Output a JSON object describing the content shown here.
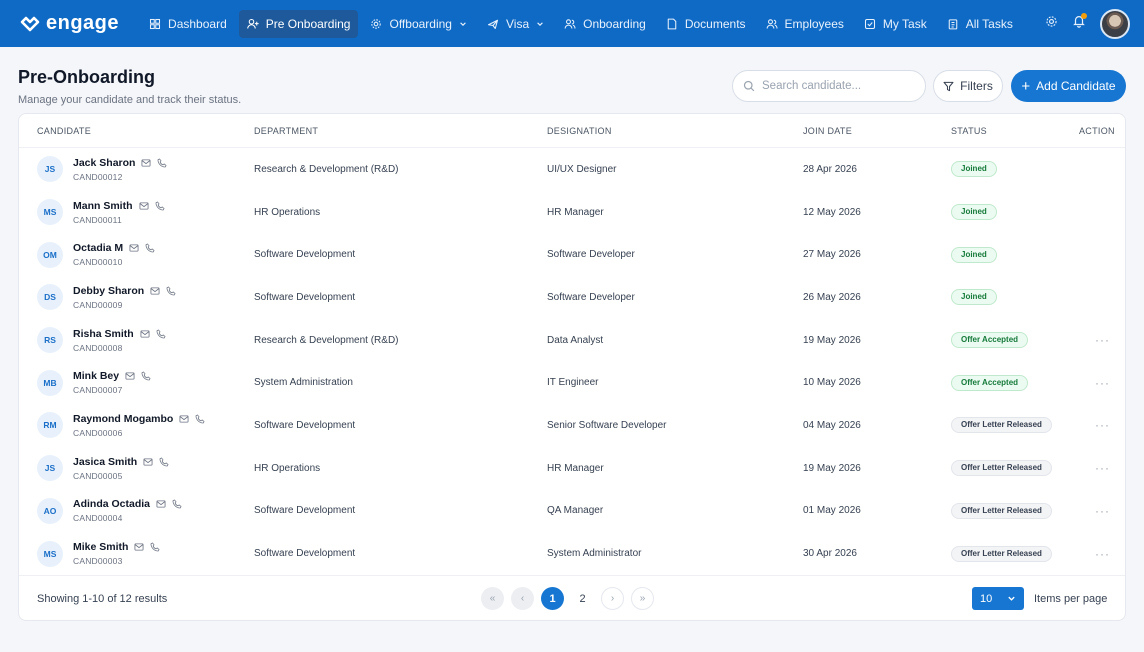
{
  "app": {
    "name": "engage"
  },
  "nav": [
    {
      "label": "Dashboard",
      "icon": "dashboard-icon",
      "active": false,
      "dropdown": false
    },
    {
      "label": "Pre Onboarding",
      "icon": "user-plus-icon",
      "active": true,
      "dropdown": false
    },
    {
      "label": "Offboarding",
      "icon": "gear-icon",
      "active": false,
      "dropdown": true
    },
    {
      "label": "Visa",
      "icon": "plane-icon",
      "active": false,
      "dropdown": true
    },
    {
      "label": "Onboarding",
      "icon": "users-icon",
      "active": false,
      "dropdown": false
    },
    {
      "label": "Documents",
      "icon": "document-icon",
      "active": false,
      "dropdown": false
    },
    {
      "label": "Employees",
      "icon": "users-icon",
      "active": false,
      "dropdown": false
    },
    {
      "label": "My Task",
      "icon": "checkbox-icon",
      "active": false,
      "dropdown": false
    },
    {
      "label": "All Tasks",
      "icon": "clipboard-icon",
      "active": false,
      "dropdown": false
    }
  ],
  "page": {
    "title": "Pre-Onboarding",
    "subtitle": "Manage your candidate and track their status."
  },
  "search": {
    "placeholder": "Search candidate...",
    "value": ""
  },
  "buttons": {
    "filters": "Filters",
    "add": "Add Candidate"
  },
  "table": {
    "headers": [
      "CANDIDATE",
      "DEPARTMENT",
      "DESIGNATION",
      "JOIN DATE",
      "STATUS",
      "ACTION"
    ],
    "rows": [
      {
        "initials": "JS",
        "name": "Jack Sharon",
        "id": "CAND00012",
        "department": "Research & Development (R&D)",
        "designation": "UI/UX Designer",
        "join_date": "28 Apr 2026",
        "status": "Joined",
        "status_kind": "joined",
        "action": ""
      },
      {
        "initials": "MS",
        "name": "Mann Smith",
        "id": "CAND00011",
        "department": "HR Operations",
        "designation": "HR Manager",
        "join_date": "12 May 2026",
        "status": "Joined",
        "status_kind": "joined",
        "action": ""
      },
      {
        "initials": "OM",
        "name": "Octadia M",
        "id": "CAND00010",
        "department": "Software Development",
        "designation": "Software Developer",
        "join_date": "27 May 2026",
        "status": "Joined",
        "status_kind": "joined",
        "action": ""
      },
      {
        "initials": "DS",
        "name": "Debby Sharon",
        "id": "CAND00009",
        "department": "Software Development",
        "designation": "Software Developer",
        "join_date": "26 May 2026",
        "status": "Joined",
        "status_kind": "joined",
        "action": ""
      },
      {
        "initials": "RS",
        "name": "Risha Smith",
        "id": "CAND00008",
        "department": "Research & Development (R&D)",
        "designation": "Data Analyst",
        "join_date": "19 May 2026",
        "status": "Offer Accepted",
        "status_kind": "accepted",
        "action": "···"
      },
      {
        "initials": "MB",
        "name": "Mink Bey",
        "id": "CAND00007",
        "department": "System Administration",
        "designation": "IT Engineer",
        "join_date": "10 May 2026",
        "status": "Offer Accepted",
        "status_kind": "accepted",
        "action": "···"
      },
      {
        "initials": "RM",
        "name": "Raymond Mogambo",
        "id": "CAND00006",
        "department": "Software Development",
        "designation": "Senior Software Developer",
        "join_date": "04 May 2026",
        "status": "Offer Letter Released",
        "status_kind": "released",
        "action": "···"
      },
      {
        "initials": "JS",
        "name": "Jasica Smith",
        "id": "CAND00005",
        "department": "HR Operations",
        "designation": "HR Manager",
        "join_date": "19 May 2026",
        "status": "Offer Letter Released",
        "status_kind": "released",
        "action": "···"
      },
      {
        "initials": "AO",
        "name": "Adinda Octadia",
        "id": "CAND00004",
        "department": "Software Development",
        "designation": "QA Manager",
        "join_date": "01 May 2026",
        "status": "Offer Letter Released",
        "status_kind": "released",
        "action": "···"
      },
      {
        "initials": "MS",
        "name": "Mike Smith",
        "id": "CAND00003",
        "department": "Software Development",
        "designation": "System Administrator",
        "join_date": "30 Apr 2026",
        "status": "Offer Letter Released",
        "status_kind": "released",
        "action": "···"
      }
    ]
  },
  "footer": {
    "showing": "Showing 1-10 of 12 results",
    "pages": [
      "1",
      "2"
    ],
    "current_page": "1",
    "per_page": "10",
    "per_page_label": "Items per page"
  },
  "colors": {
    "brand": "#0f6ac6",
    "accent": "#1676d2",
    "success": "#157a3b"
  }
}
